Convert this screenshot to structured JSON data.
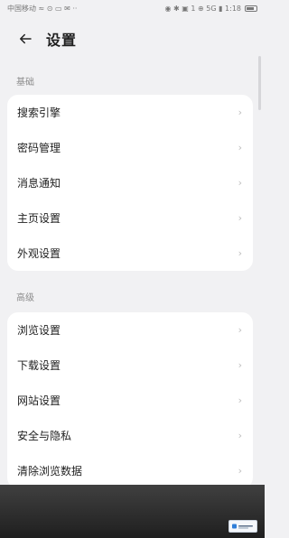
{
  "status_bar": {
    "left": "中国移动 ≈ ⊙ ▭ ✉ ··",
    "right": "◉ ✱ ▣ 1 ⊕ 5G ▮ 1:18"
  },
  "header": {
    "title": "设置",
    "back_icon": "arrow-left-icon"
  },
  "sections": [
    {
      "title": "基础",
      "items": [
        {
          "label": "搜索引擎"
        },
        {
          "label": "密码管理"
        },
        {
          "label": "消息通知"
        },
        {
          "label": "主页设置"
        },
        {
          "label": "外观设置"
        }
      ]
    },
    {
      "title": "高级",
      "items": [
        {
          "label": "浏览设置"
        },
        {
          "label": "下载设置"
        },
        {
          "label": "网站设置"
        },
        {
          "label": "安全与隐私"
        },
        {
          "label": "清除浏览数据"
        }
      ]
    }
  ],
  "ui": {
    "chevron": "›"
  },
  "colors": {
    "background": "#f1f1f3",
    "card": "#ffffff",
    "text": "#1f1f1f",
    "muted": "#8c8c8c"
  }
}
